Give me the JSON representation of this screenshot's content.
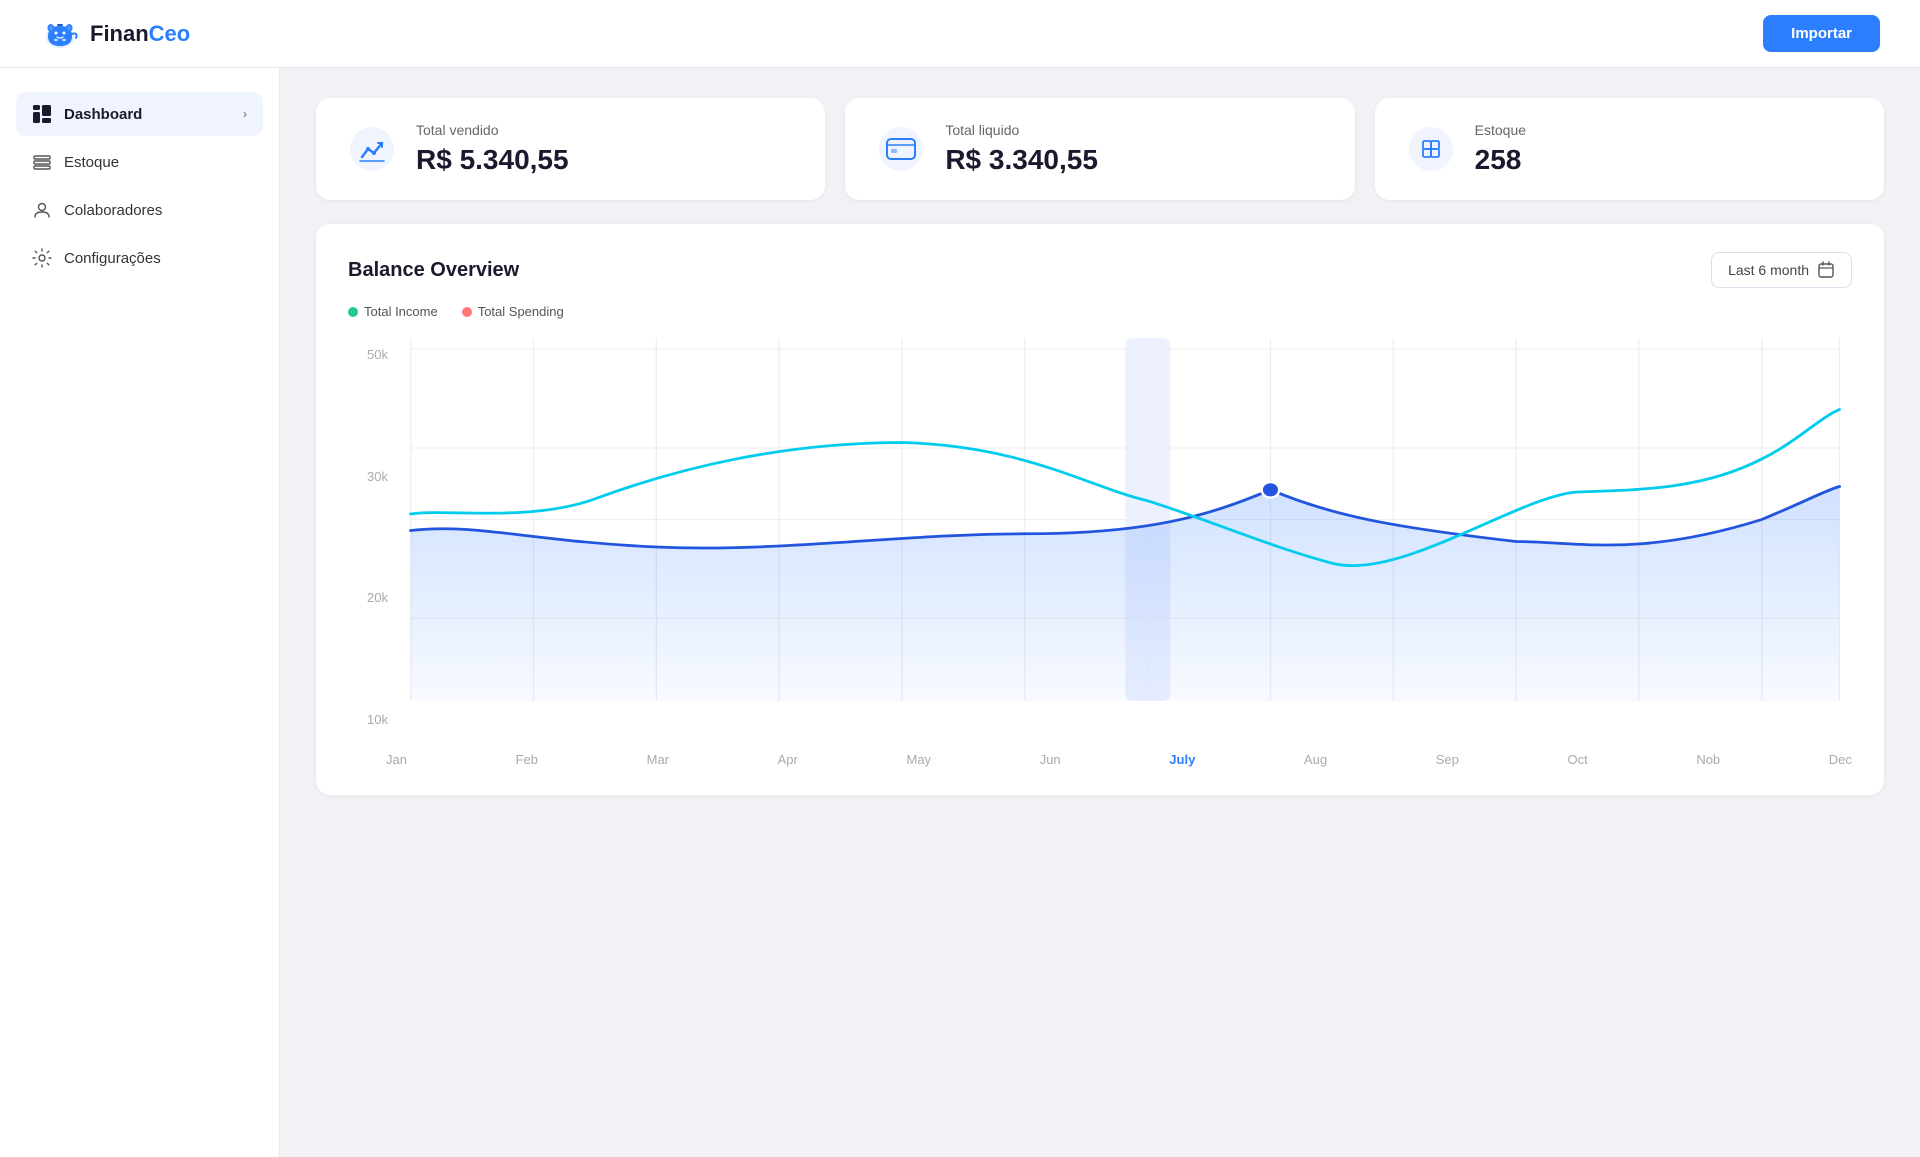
{
  "header": {
    "logo_text_1": "Finan",
    "logo_text_2": "Ceo",
    "import_label": "Importar"
  },
  "sidebar": {
    "items": [
      {
        "id": "dashboard",
        "label": "Dashboard",
        "active": true,
        "has_chevron": true,
        "icon": "dashboard-icon"
      },
      {
        "id": "estoque",
        "label": "Estoque",
        "active": false,
        "has_chevron": false,
        "icon": "estoque-icon"
      },
      {
        "id": "colaboradores",
        "label": "Colaboradores",
        "active": false,
        "has_chevron": false,
        "icon": "colaboradores-icon"
      },
      {
        "id": "configuracoes",
        "label": "Configurações",
        "active": false,
        "has_chevron": false,
        "icon": "configuracoes-icon"
      }
    ]
  },
  "stats": [
    {
      "id": "total-vendido",
      "label": "Total vendido",
      "value": "R$ 5.340,55",
      "icon": "vendido-icon"
    },
    {
      "id": "total-liquido",
      "label": "Total liquido",
      "value": "R$ 3.340,55",
      "icon": "liquido-icon"
    },
    {
      "id": "estoque",
      "label": "Estoque",
      "value": "258",
      "icon": "estoque-stat-icon"
    }
  ],
  "balance": {
    "title": "Balance Overview",
    "period_label": "Last 6 month",
    "legend": [
      {
        "label": "Total Income",
        "color": "#22cc88"
      },
      {
        "label": "Total Spending",
        "color": "#ff7777"
      }
    ],
    "y_labels": [
      "50k",
      "30k",
      "20k",
      "10k"
    ],
    "x_labels": [
      {
        "label": "Jan",
        "active": false
      },
      {
        "label": "Feb",
        "active": false
      },
      {
        "label": "Mar",
        "active": false
      },
      {
        "label": "Apr",
        "active": false
      },
      {
        "label": "May",
        "active": false
      },
      {
        "label": "Jun",
        "active": false
      },
      {
        "label": "July",
        "active": true
      },
      {
        "label": "Aug",
        "active": false
      },
      {
        "label": "Sep",
        "active": false
      },
      {
        "label": "Oct",
        "active": false
      },
      {
        "label": "Nob",
        "active": false
      },
      {
        "label": "Dec",
        "active": false
      }
    ]
  }
}
